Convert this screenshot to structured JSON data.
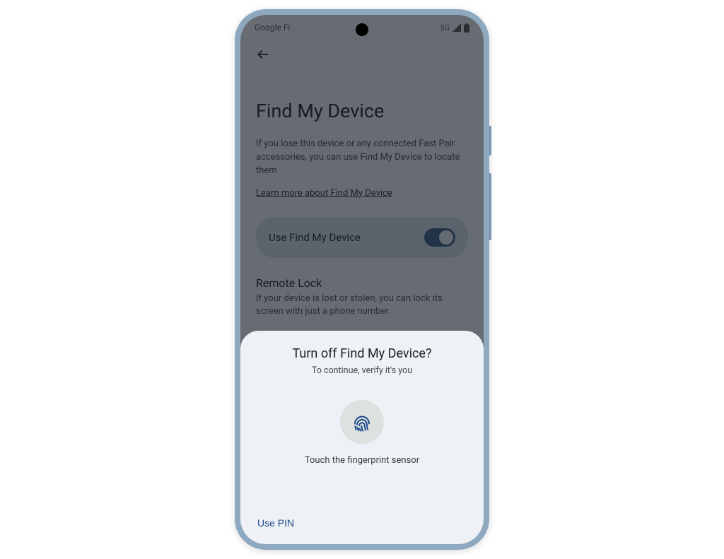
{
  "status": {
    "carrier": "Google Fi",
    "network": "5G"
  },
  "settings": {
    "title": "Find My Device",
    "description": "If you lose this device or any connected Fast Pair accessories, you can use Find My Device to locate them",
    "learn_link": "Learn more about Find My Device",
    "toggle_label": "Use Find My Device",
    "remote_lock_title": "Remote Lock",
    "remote_lock_desc": "If your device is lost or stolen, you can lock its screen with just a phone number."
  },
  "sheet": {
    "title": "Turn off Find My Device?",
    "subtitle": "To continue, verify it's you",
    "instruction": "Touch the fingerprint sensor",
    "use_pin": "Use PIN"
  }
}
